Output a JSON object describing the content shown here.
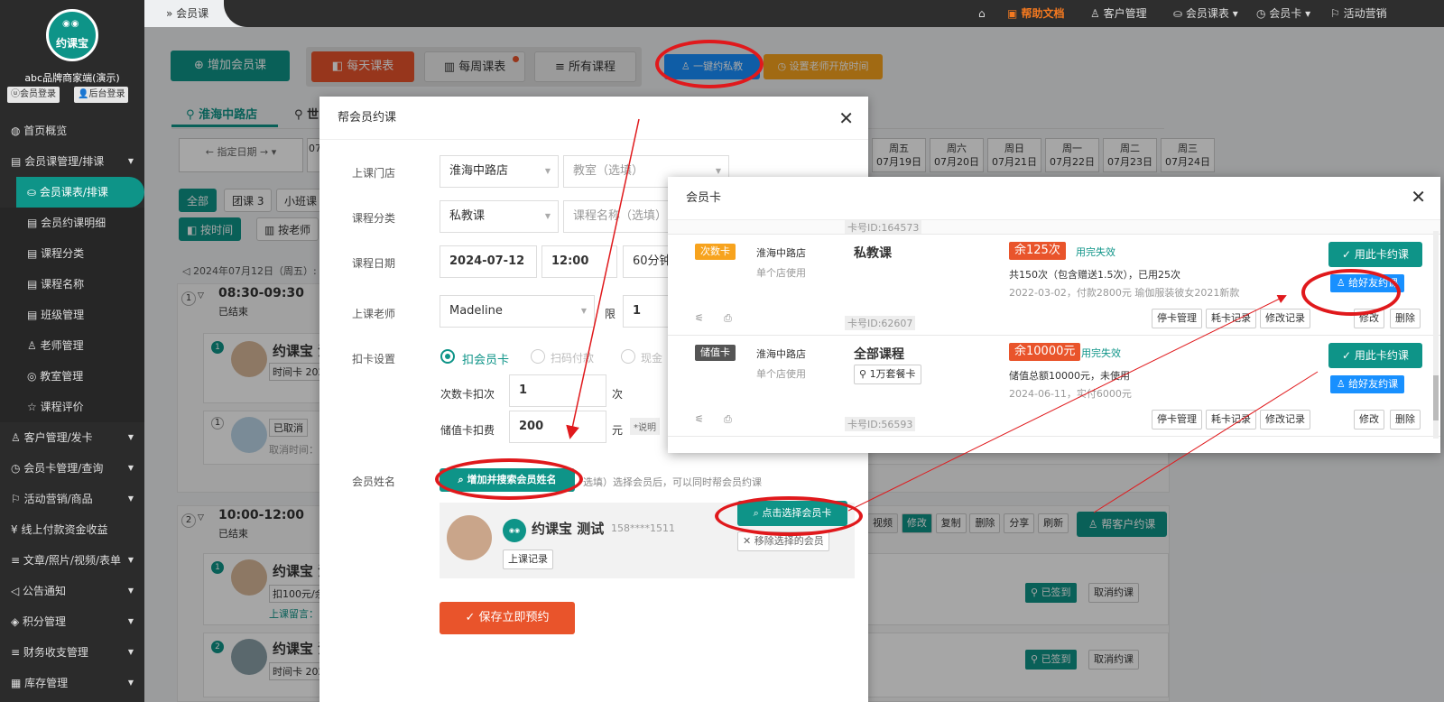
{
  "sidebar": {
    "logo_text": "约课宝",
    "brand_name": "abc品牌商家端(演示)",
    "member_login": "会员登录",
    "admin_login": "后台登录",
    "items": [
      {
        "label": "首页概览",
        "type": "top"
      },
      {
        "label": "会员课管理/排课",
        "type": "top",
        "expanded": true
      },
      {
        "label": "会员课表/排课",
        "type": "sub",
        "active": true
      },
      {
        "label": "会员约课明细",
        "type": "sub"
      },
      {
        "label": "课程分类",
        "type": "sub"
      },
      {
        "label": "课程名称",
        "type": "sub"
      },
      {
        "label": "班级管理",
        "type": "sub"
      },
      {
        "label": "老师管理",
        "type": "sub"
      },
      {
        "label": "教室管理",
        "type": "sub"
      },
      {
        "label": "课程评价",
        "type": "sub"
      },
      {
        "label": "客户管理/发卡",
        "type": "top"
      },
      {
        "label": "会员卡管理/查询",
        "type": "top"
      },
      {
        "label": "活动营销/商品",
        "type": "top"
      },
      {
        "label": "线上付款资金收益",
        "type": "top"
      },
      {
        "label": "文章/照片/视频/表单",
        "type": "top"
      },
      {
        "label": "公告通知",
        "type": "top"
      },
      {
        "label": "积分管理",
        "type": "top"
      },
      {
        "label": "财务收支管理",
        "type": "top"
      },
      {
        "label": "库存管理",
        "type": "top"
      }
    ]
  },
  "topbar": {
    "breadcrumb": "会员课",
    "home": "⌂",
    "help": "帮助文档",
    "customer": "客户管理",
    "schedule": "会员课表",
    "card": "会员卡",
    "marketing": "活动营销"
  },
  "toolbar": {
    "add_course": "增加会员课",
    "daily": "每天课表",
    "weekly": "每周课表",
    "all": "所有课程",
    "private": "一键约私教",
    "teacher_time": "设置老师开放时间"
  },
  "stores": [
    "淮海中路店",
    "世"
  ],
  "date_nav": {
    "label": "← 指定日期 →",
    "partial": "07",
    "days": [
      {
        "w": "周五",
        "d": "07月19日"
      },
      {
        "w": "周六",
        "d": "07月20日"
      },
      {
        "w": "周日",
        "d": "07月21日"
      },
      {
        "w": "周一",
        "d": "07月22日"
      },
      {
        "w": "周二",
        "d": "07月23日"
      },
      {
        "w": "周三",
        "d": "07月24日"
      }
    ]
  },
  "filters": {
    "all": "全部",
    "group": "团课 3",
    "small": "小班课",
    "by_time": "按时间",
    "by_teacher": "按老师"
  },
  "bg_list": {
    "date_line": "2024年07月12日（周五）:",
    "slot1_time": "08:30-09:30",
    "slot1_status": "已结束",
    "slot2_time": "10:00-12:00",
    "slot2_status": "已结束",
    "name1": "约课宝 法",
    "card1": "时间卡 202",
    "cancelled": "已取消",
    "cancel_time": "取消时间：",
    "card2": "扣100元/余",
    "msg": "上课留言：",
    "card3": "时间卡 202",
    "actions": [
      "视频",
      "修改",
      "复制",
      "删除",
      "分享",
      "刷新"
    ],
    "help_book": "帮客户约课",
    "signed": "已签到",
    "cancel_booking": "取消约课"
  },
  "modal": {
    "title": "帮会员约课",
    "store_label": "上课门店",
    "store_value": "淮海中路店",
    "room_placeholder": "教室（选填）",
    "category_label": "课程分类",
    "category_value": "私教课",
    "course_placeholder": "课程名称（选填）",
    "date_label": "课程日期",
    "date_value": "2024-07-12",
    "time_value": "12:00",
    "duration_value": "60分钟",
    "teacher_label": "上课老师",
    "teacher_value": "Madeline",
    "limit_label": "限",
    "limit_value": "1",
    "deduct_label": "扣卡设置",
    "opt1": "扣会员卡",
    "opt2": "扫码付款",
    "opt3": "现金",
    "count_label": "次数卡扣次",
    "count_value": "1",
    "count_unit": "次",
    "value_label": "储值卡扣费",
    "value_value": "200",
    "value_unit": "元",
    "value_note": "*说明",
    "member_label": "会员姓名",
    "add_member": "增加并搜索会员姓名",
    "member_hint": "选填）选择会员后，可以同时帮会员约课",
    "member_name": "约课宝 测试",
    "member_phone": "158****1511",
    "records": "上课记录",
    "choose_card": "点击选择会员卡",
    "remove_member": "移除选择的会员",
    "save": "保存立即预约"
  },
  "card_modal": {
    "title": "会员卡",
    "top_partial_id": "卡号ID:164573",
    "cards": [
      {
        "type": "次数卡",
        "type_color": "#f7a31e",
        "store": "淮海中路店",
        "scope": "单个店使用",
        "course": "私教课",
        "balance": "余125次",
        "expiry": "用完失效",
        "detail": "共150次（包含赠送1.5次），已用25次",
        "note": "2022-03-02，付款2800元 瑜伽服装彼女2021新款",
        "card_id": "卡号ID:62607",
        "use": "用此卡约课",
        "friend": "给好友约课",
        "ops": [
          "停卡管理",
          "耗卡记录",
          "修改记录"
        ],
        "edit": "修改",
        "del": "删除"
      },
      {
        "type": "储值卡",
        "type_color": "#555555",
        "store": "淮海中路店",
        "scope": "单个店使用",
        "course": "全部课程",
        "package": "1万套餐卡",
        "balance": "余10000元",
        "expiry": "用完失效",
        "detail": "储值总额10000元，未使用",
        "note": "2024-06-11，实付6000元",
        "card_id": "卡号ID:56593",
        "use": "用此卡约课",
        "friend": "给好友约课",
        "ops": [
          "停卡管理",
          "耗卡记录",
          "修改记录"
        ],
        "edit": "修改",
        "del": "删除"
      }
    ]
  },
  "colors": {
    "accent": "#0e9488",
    "orange": "#e9542b",
    "annotation_red": "#e0191c"
  }
}
